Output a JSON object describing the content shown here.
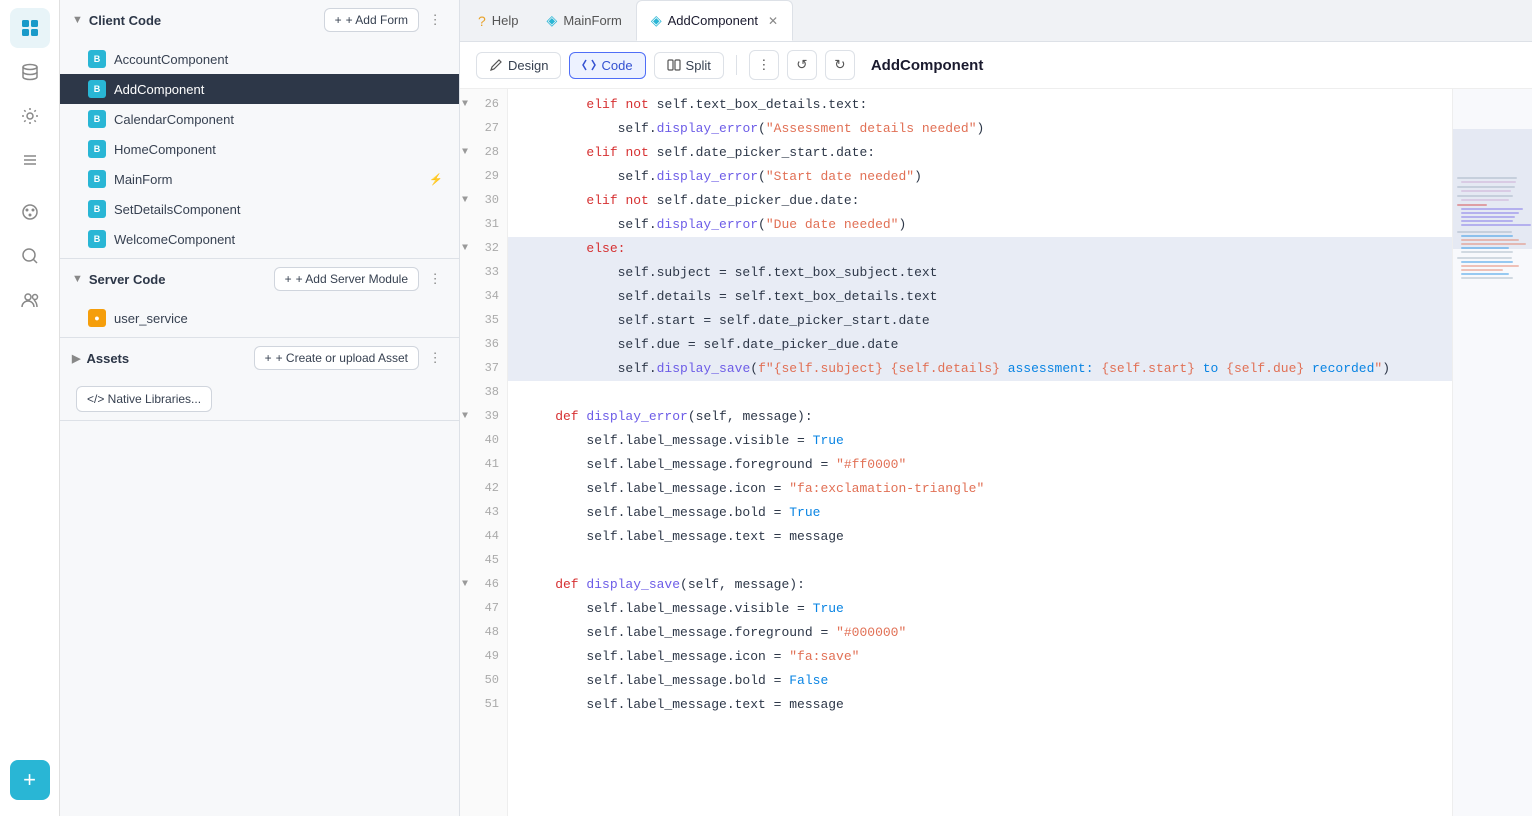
{
  "sidebar": {
    "icons": [
      {
        "name": "grid-icon",
        "symbol": "⊞",
        "active": true
      },
      {
        "name": "database-icon",
        "symbol": "🗄",
        "active": false
      },
      {
        "name": "settings-icon",
        "symbol": "⚙",
        "active": false
      },
      {
        "name": "list-icon",
        "symbol": "☰",
        "active": false
      },
      {
        "name": "palette-icon",
        "symbol": "🎨",
        "active": false
      },
      {
        "name": "search-icon",
        "symbol": "🔍",
        "active": false
      },
      {
        "name": "users-icon",
        "symbol": "👥",
        "active": false
      }
    ],
    "add_label": "+"
  },
  "client_code": {
    "section_title": "Client Code",
    "add_button": "+ Add Form",
    "items": [
      {
        "id": "AccountComponent",
        "label": "AccountComponent",
        "active": false
      },
      {
        "id": "AddComponent",
        "label": "AddComponent",
        "active": true
      },
      {
        "id": "CalendarComponent",
        "label": "CalendarComponent",
        "active": false
      },
      {
        "id": "HomeComponent",
        "label": "HomeComponent",
        "active": false
      },
      {
        "id": "MainForm",
        "label": "MainForm",
        "active": false,
        "has_suffix": true
      },
      {
        "id": "SetDetailsComponent",
        "label": "SetDetailsComponent",
        "active": false
      },
      {
        "id": "WelcomeComponent",
        "label": "WelcomeComponent",
        "active": false
      }
    ]
  },
  "server_code": {
    "section_title": "Server Code",
    "add_button": "+ Add Server Module",
    "items": [
      {
        "id": "user_service",
        "label": "user_service",
        "icon_type": "orange"
      }
    ]
  },
  "assets": {
    "section_title": "Assets",
    "add_button": "+ Create or upload Asset",
    "items": [],
    "native_lib_label": "</> Native Libraries..."
  },
  "tabs": [
    {
      "id": "help",
      "label": "Help",
      "icon": "?",
      "active": false,
      "closeable": false
    },
    {
      "id": "mainform",
      "label": "MainForm",
      "icon": "◈",
      "active": false,
      "closeable": false
    },
    {
      "id": "addcomponent",
      "label": "AddComponent",
      "icon": "◈",
      "active": true,
      "closeable": true
    }
  ],
  "toolbar": {
    "design_label": "Design",
    "code_label": "Code",
    "split_label": "Split",
    "editor_title": "AddComponent"
  },
  "code": {
    "lines": [
      {
        "num": 26,
        "collapse": true,
        "content": "    elif not self.text_box_details.text:",
        "highlighted": false,
        "tokens": [
          {
            "t": "kw",
            "v": "        elif"
          },
          {
            "t": "normal",
            "v": " "
          },
          {
            "t": "kw",
            "v": "not"
          },
          {
            "t": "normal",
            "v": " self.text_box_details.text:"
          }
        ]
      },
      {
        "num": 27,
        "content": "        self.display_error(\"Assessment details needed\")",
        "highlighted": false,
        "tokens": [
          {
            "t": "normal",
            "v": "            self."
          },
          {
            "t": "fn",
            "v": "display_error"
          },
          {
            "t": "normal",
            "v": "("
          },
          {
            "t": "str",
            "v": "\"Assessment details needed\""
          },
          {
            "t": "normal",
            "v": ")"
          }
        ]
      },
      {
        "num": 28,
        "collapse": true,
        "content": "    elif not self.date_picker_start.date:",
        "highlighted": false,
        "tokens": [
          {
            "t": "kw",
            "v": "        elif"
          },
          {
            "t": "normal",
            "v": " "
          },
          {
            "t": "kw",
            "v": "not"
          },
          {
            "t": "normal",
            "v": " self.date_picker_start.date:"
          }
        ]
      },
      {
        "num": 29,
        "content": "        self.display_error(\"Start date needed\")",
        "highlighted": false,
        "tokens": [
          {
            "t": "normal",
            "v": "            self."
          },
          {
            "t": "fn",
            "v": "display_error"
          },
          {
            "t": "normal",
            "v": "("
          },
          {
            "t": "str",
            "v": "\"Start date needed\""
          },
          {
            "t": "normal",
            "v": ")"
          }
        ]
      },
      {
        "num": 30,
        "collapse": true,
        "content": "    elif not self.date_picker_due.date:",
        "highlighted": false,
        "tokens": [
          {
            "t": "kw",
            "v": "        elif"
          },
          {
            "t": "normal",
            "v": " "
          },
          {
            "t": "kw",
            "v": "not"
          },
          {
            "t": "normal",
            "v": " self.date_picker_due.date:"
          }
        ]
      },
      {
        "num": 31,
        "content": "        self.display_error(\"Due date needed\")",
        "highlighted": false,
        "tokens": [
          {
            "t": "normal",
            "v": "            self."
          },
          {
            "t": "fn",
            "v": "display_error"
          },
          {
            "t": "normal",
            "v": "("
          },
          {
            "t": "str",
            "v": "\"Due date needed\""
          },
          {
            "t": "normal",
            "v": ")"
          }
        ]
      },
      {
        "num": 32,
        "collapse": true,
        "content": "    else:",
        "highlighted": true,
        "tokens": [
          {
            "t": "kw",
            "v": "        else:"
          }
        ]
      },
      {
        "num": 33,
        "content": "        self.subject = self.text_box_subject.text",
        "highlighted": true,
        "tokens": [
          {
            "t": "normal",
            "v": "            self.subject = self.text_box_subject.text"
          }
        ]
      },
      {
        "num": 34,
        "content": "        self.details = self.text_box_details.text",
        "highlighted": true,
        "tokens": [
          {
            "t": "normal",
            "v": "            self.details = self.text_box_details.text"
          }
        ]
      },
      {
        "num": 35,
        "content": "        self.start = self.date_picker_start.date",
        "highlighted": true,
        "tokens": [
          {
            "t": "normal",
            "v": "            self.start = self.date_picker_start.date"
          }
        ]
      },
      {
        "num": 36,
        "content": "        self.due = self.date_picker_due.date",
        "highlighted": true,
        "tokens": [
          {
            "t": "normal",
            "v": "            self.due = self.date_picker_due.date"
          }
        ]
      },
      {
        "num": 37,
        "content": "        self.display_save(f\"{self.subject} {self.details} assessment: {self.start} to {self.due} recorded\")",
        "highlighted": true,
        "tokens": [
          {
            "t": "normal",
            "v": "            self."
          },
          {
            "t": "fn",
            "v": "display_save"
          },
          {
            "t": "normal",
            "v": "("
          },
          {
            "t": "str",
            "v": "f\"{self.subject} {self.details}"
          },
          {
            "t": "attr",
            "v": " assessment:"
          },
          {
            "t": "str",
            "v": " {self.start}"
          },
          {
            "t": "attr",
            "v": " to"
          },
          {
            "t": "str",
            "v": " {self.due}"
          },
          {
            "t": "attr",
            "v": " recorded"
          },
          {
            "t": "str",
            "v": "\""
          },
          {
            "t": "normal",
            "v": ")"
          }
        ]
      },
      {
        "num": 38,
        "content": "",
        "highlighted": false,
        "tokens": []
      },
      {
        "num": 39,
        "collapse": true,
        "content": "    def display_error(self, message):",
        "highlighted": false,
        "tokens": [
          {
            "t": "kw",
            "v": "    def"
          },
          {
            "t": "normal",
            "v": " "
          },
          {
            "t": "fn",
            "v": "display_error"
          },
          {
            "t": "normal",
            "v": "(self, message):"
          }
        ]
      },
      {
        "num": 40,
        "content": "        self.label_message.visible = True",
        "highlighted": false,
        "tokens": [
          {
            "t": "normal",
            "v": "        self.label_message.visible = "
          },
          {
            "t": "kw-blue",
            "v": "True"
          }
        ]
      },
      {
        "num": 41,
        "content": "        self.label_message.foreground = \"#ff0000\"",
        "highlighted": false,
        "tokens": [
          {
            "t": "normal",
            "v": "        self.label_message.foreground = "
          },
          {
            "t": "str",
            "v": "\"#ff0000\""
          }
        ]
      },
      {
        "num": 42,
        "content": "        self.label_message.icon = \"fa:exclamation-triangle\"",
        "highlighted": false,
        "tokens": [
          {
            "t": "normal",
            "v": "        self.label_message.icon = "
          },
          {
            "t": "str",
            "v": "\"fa:exclamation-triangle\""
          }
        ]
      },
      {
        "num": 43,
        "content": "        self.label_message.bold = True",
        "highlighted": false,
        "tokens": [
          {
            "t": "normal",
            "v": "        self.label_message.bold = "
          },
          {
            "t": "kw-blue",
            "v": "True"
          }
        ]
      },
      {
        "num": 44,
        "content": "        self.label_message.text = message",
        "highlighted": false,
        "tokens": [
          {
            "t": "normal",
            "v": "        self.label_message.text = message"
          }
        ]
      },
      {
        "num": 45,
        "content": "",
        "highlighted": false,
        "tokens": []
      },
      {
        "num": 46,
        "collapse": true,
        "content": "    def display_save(self, message):",
        "highlighted": false,
        "tokens": [
          {
            "t": "kw",
            "v": "    def"
          },
          {
            "t": "normal",
            "v": " "
          },
          {
            "t": "fn",
            "v": "display_save"
          },
          {
            "t": "normal",
            "v": "(self, message):"
          }
        ]
      },
      {
        "num": 47,
        "content": "        self.label_message.visible = True",
        "highlighted": false,
        "tokens": [
          {
            "t": "normal",
            "v": "        self.label_message.visible = "
          },
          {
            "t": "kw-blue",
            "v": "True"
          }
        ]
      },
      {
        "num": 48,
        "content": "        self.label_message.foreground = \"#000000\"",
        "highlighted": false,
        "tokens": [
          {
            "t": "normal",
            "v": "        self.label_message.foreground = "
          },
          {
            "t": "str",
            "v": "\"#000000\""
          }
        ]
      },
      {
        "num": 49,
        "content": "        self.label_message.icon = \"fa:save\"",
        "highlighted": false,
        "tokens": [
          {
            "t": "normal",
            "v": "        self.label_message.icon = "
          },
          {
            "t": "str",
            "v": "\"fa:save\""
          }
        ]
      },
      {
        "num": 50,
        "content": "        self.label_message.bold = False",
        "highlighted": false,
        "tokens": [
          {
            "t": "normal",
            "v": "        self.label_message.bold = "
          },
          {
            "t": "kw-blue",
            "v": "False"
          }
        ]
      },
      {
        "num": 51,
        "content": "        self.label_message.text = message",
        "highlighted": false,
        "tokens": [
          {
            "t": "normal",
            "v": "        self.label_message.text = message"
          }
        ]
      }
    ]
  }
}
